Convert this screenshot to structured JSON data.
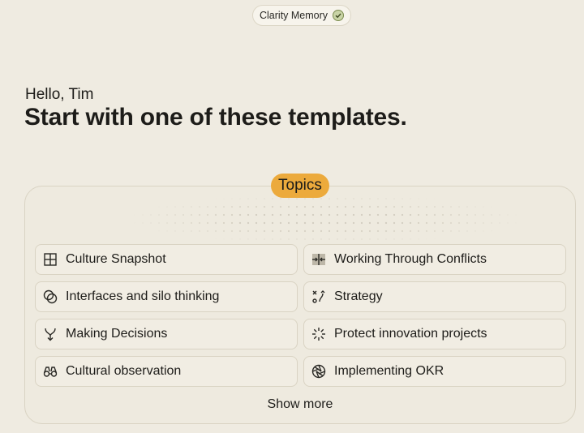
{
  "header": {
    "memory_label": "Clarity Memory",
    "memory_icon": "check-circle-icon"
  },
  "greeting": "Hello, Tim",
  "headline": "Start with one of these templates.",
  "topics": {
    "badge_label": "Topics",
    "show_more_label": "Show more",
    "items": [
      {
        "label": "Culture Snapshot",
        "icon": "grid-icon"
      },
      {
        "label": "Working Through Conflicts",
        "icon": "arrows-converge-icon"
      },
      {
        "label": "Interfaces and silo thinking",
        "icon": "overlap-circles-icon"
      },
      {
        "label": "Strategy",
        "icon": "tactics-icon"
      },
      {
        "label": "Making Decisions",
        "icon": "fork-arrow-icon"
      },
      {
        "label": "Protect innovation projects",
        "icon": "loader-icon"
      },
      {
        "label": "Cultural observation",
        "icon": "binoculars-icon"
      },
      {
        "label": "Implementing OKR",
        "icon": "aperture-icon"
      }
    ]
  },
  "colors": {
    "background": "#efebe1",
    "accent": "#ecaa3c"
  }
}
